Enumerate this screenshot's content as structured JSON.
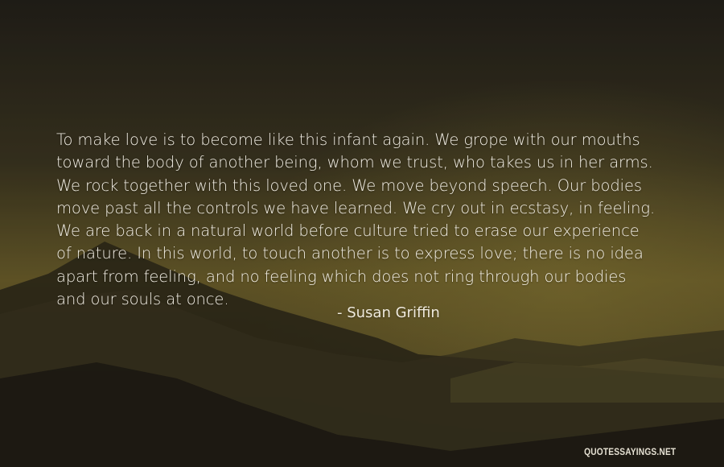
{
  "quote": {
    "lines": [
      "To make love is to become like this infant again. We grope with our mouths",
      "toward the body of another being, whom we trust, who takes us in her arms.",
      "We rock together with this loved one. We move beyond speech. Our bodies",
      "move past all the controls we have learned. We cry out in ecstasy, in feeling.",
      "We are back in a natural world before culture tried to erase our experience",
      "of nature. In this world, to touch another is to express love; there is no idea",
      "apart from feeling, and no feeling which does not ring through our bodies",
      "and our souls at once."
    ]
  },
  "author": "- Susan Griffin",
  "watermark": "QUOTESSAYINGS.NET"
}
